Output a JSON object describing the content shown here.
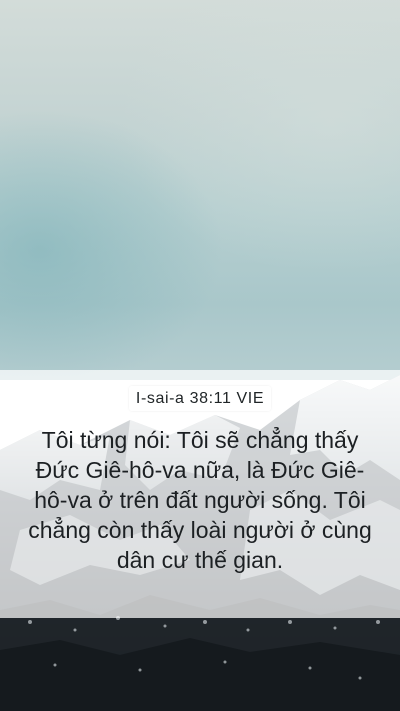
{
  "card": {
    "reference": "I-sai-a 38:11 VIE",
    "verse_text": "Tôi từng nói: Tôi sẽ chẳng thấy Đức Giê-hô-va nữa, là Đức Giê-hô-va ở trên đất người sống. Tôi chẳng còn thấy loài người ở cùng dân cư thế gian."
  },
  "background": {
    "description_colors": {
      "sky_top": "#d3dcd9",
      "sky_bottom": "#a9c7ca",
      "mountain_dark": "#1c2126",
      "snow": "#e8eef0"
    }
  }
}
